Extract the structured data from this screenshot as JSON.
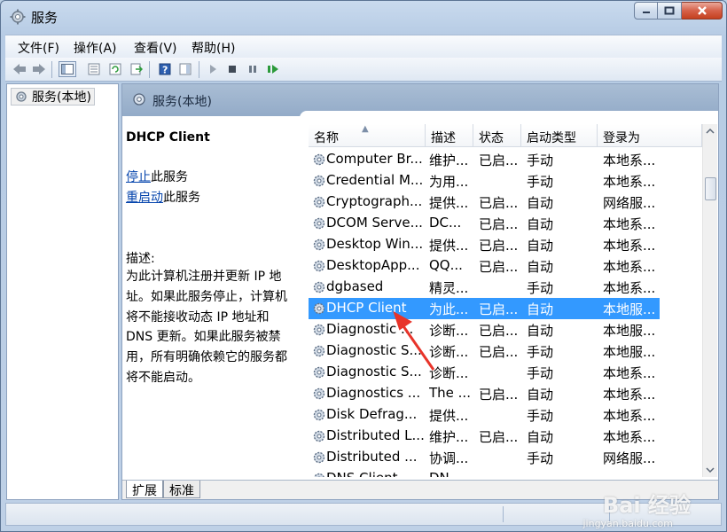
{
  "window": {
    "title": "服务"
  },
  "menu": [
    "文件(F)",
    "操作(A)",
    "查看(V)",
    "帮助(H)"
  ],
  "tree": {
    "root": "服务(本地)"
  },
  "panel": {
    "header": "服务(本地)",
    "selected_name": "DHCP Client",
    "stop_link": "停止",
    "stop_suffix": "此服务",
    "restart_link": "重启动",
    "restart_suffix": "此服务",
    "desc_label": "描述:",
    "desc_lines": [
      "为此计算机注册并更新 IP 地",
      "址。如果此服务停止，计算机",
      "将不能接收动态 IP 地址和",
      "DNS 更新。如果此服务被禁",
      "用，所有明确依赖它的服务都",
      "将不能启动。"
    ]
  },
  "columns": [
    "名称",
    "描述",
    "状态",
    "启动类型",
    "登录为"
  ],
  "rows": [
    [
      "Computer Br...",
      "维护...",
      "已启...",
      "手动",
      "本地系..."
    ],
    [
      "Credential M...",
      "为用...",
      "",
      "手动",
      "本地系..."
    ],
    [
      "Cryptograph...",
      "提供...",
      "已启...",
      "自动",
      "网络服..."
    ],
    [
      "DCOM Serve...",
      "DC...",
      "已启...",
      "自动",
      "本地系..."
    ],
    [
      "Desktop Win...",
      "提供...",
      "已启...",
      "自动",
      "本地系..."
    ],
    [
      "DesktopApp...",
      "QQ...",
      "已启...",
      "自动",
      "本地系..."
    ],
    [
      "dgbased",
      "精灵...",
      "",
      "手动",
      "本地系..."
    ],
    [
      "DHCP Client",
      "为此...",
      "已启...",
      "自动",
      "本地服..."
    ],
    [
      "Diagnostic ...",
      "诊断...",
      "已启...",
      "自动",
      "本地服..."
    ],
    [
      "Diagnostic S...",
      "诊断...",
      "已启...",
      "手动",
      "本地服..."
    ],
    [
      "Diagnostic S...",
      "诊断...",
      "",
      "手动",
      "本地系..."
    ],
    [
      "Diagnostics ...",
      "The ...",
      "已启...",
      "自动",
      "本地系..."
    ],
    [
      "Disk Defrag...",
      "提供...",
      "",
      "手动",
      "本地系..."
    ],
    [
      "Distributed L...",
      "维护...",
      "已启...",
      "自动",
      "本地系..."
    ],
    [
      "Distributed ...",
      "协调...",
      "",
      "手动",
      "网络服..."
    ],
    [
      "DNS Client",
      "DN...",
      "",
      "",
      ""
    ]
  ],
  "selected_row": 7,
  "tabs": [
    "扩展",
    "标准"
  ],
  "watermark": {
    "main": "Bai 经验",
    "sub": "jingyan.baidu.com"
  },
  "colors": {
    "selection": "#3399ff",
    "annotation_arrow": "#e8342a"
  }
}
